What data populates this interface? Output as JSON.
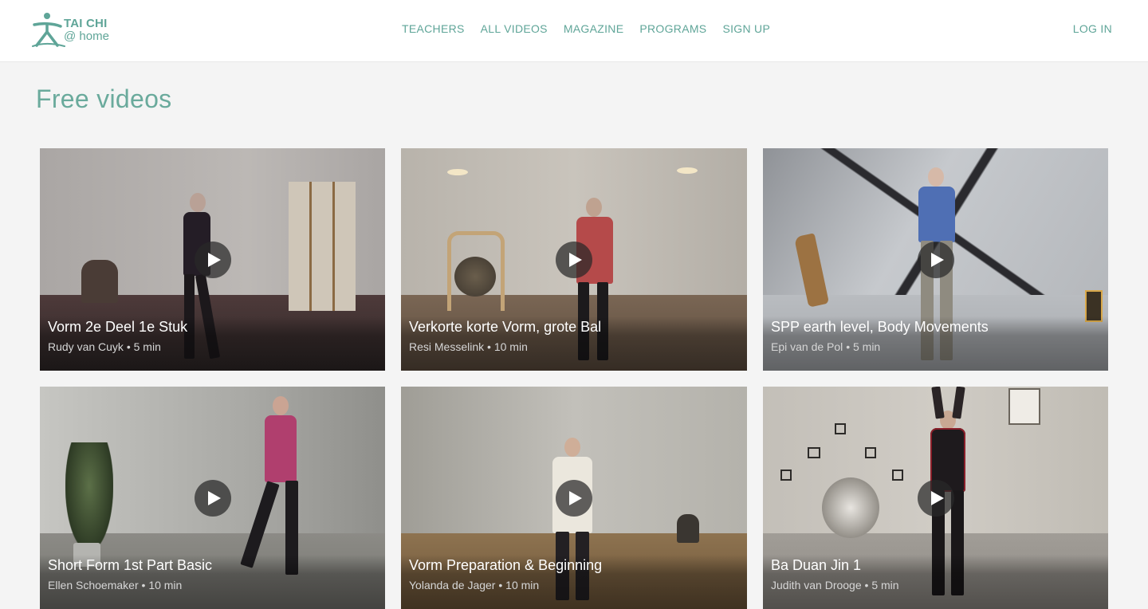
{
  "header": {
    "logo_line1": "TAI CHI",
    "logo_line2": "@ home",
    "nav": [
      "TEACHERS",
      "ALL VIDEOS",
      "MAGAZINE",
      "PROGRAMS",
      "SIGN UP"
    ],
    "login": "LOG IN"
  },
  "page_title": "Free videos",
  "videos": [
    {
      "title": "Vorm 2e Deel 1e Stuk",
      "teacher": "Rudy van Cuyk",
      "duration": "5 min"
    },
    {
      "title": "Verkorte korte Vorm, grote Bal",
      "teacher": "Resi Messelink",
      "duration": "10 min"
    },
    {
      "title": "SPP earth level, Body Movements",
      "teacher": "Epi van de Pol",
      "duration": "5 min"
    },
    {
      "title": "Short Form 1st Part Basic",
      "teacher": "Ellen Schoemaker",
      "duration": "10 min"
    },
    {
      "title": "Vorm Preparation & Beginning",
      "teacher": "Yolanda de Jager",
      "duration": "10 min"
    },
    {
      "title": "Ba Duan Jin 1",
      "teacher": "Judith van Drooge",
      "duration": "5 min"
    }
  ],
  "meta_separator": "•",
  "colors": {
    "accent": "#5fa598",
    "page_background": "#f4f4f4",
    "header_background": "#ffffff"
  },
  "icons": [
    "tai-chi-logo-icon",
    "play-icon"
  ]
}
